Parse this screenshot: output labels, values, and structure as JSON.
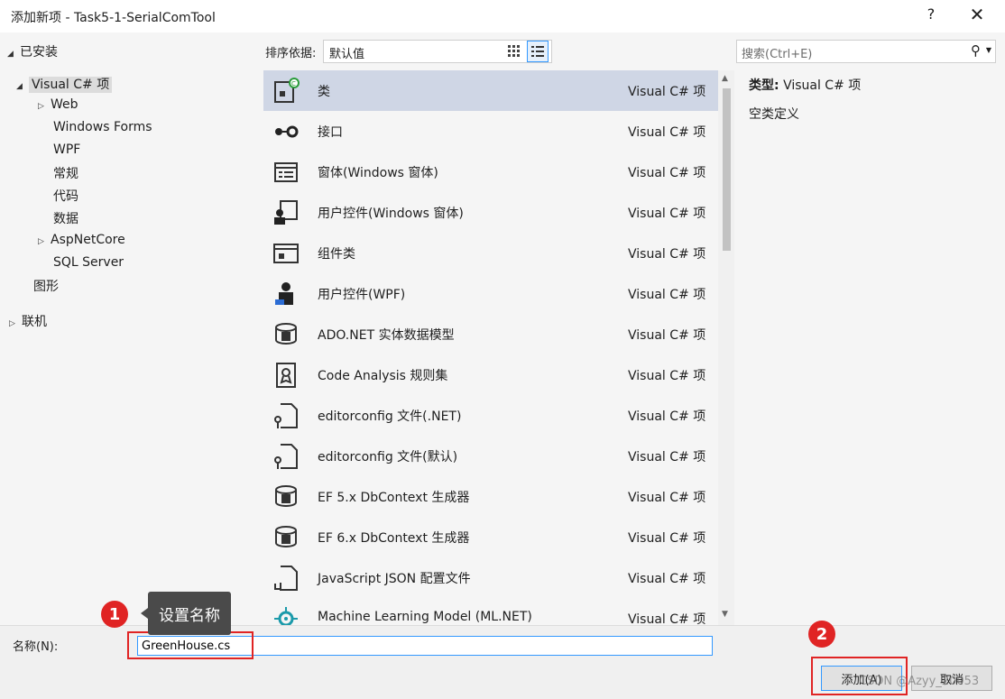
{
  "window": {
    "title": "添加新项 - Task5-1-SerialComTool",
    "help": "?",
    "close": "✕"
  },
  "tree": {
    "installed": "已安装",
    "visual_csharp": "Visual C# 项",
    "web": "Web",
    "windows_forms": "Windows Forms",
    "wpf": "WPF",
    "normal": "常规",
    "code": "代码",
    "data": "数据",
    "aspnetcore": "AspNetCore",
    "sqlserver": "SQL Server",
    "graphics": "图形",
    "online": "联机"
  },
  "sort": {
    "label": "排序依据:",
    "value": "默认值"
  },
  "search": {
    "placeholder": "搜索(Ctrl+E)"
  },
  "items": [
    {
      "name": "类",
      "type": "Visual C# 项",
      "icon": "class-icon"
    },
    {
      "name": "接口",
      "type": "Visual C# 项",
      "icon": "interface-icon"
    },
    {
      "name": "窗体(Windows 窗体)",
      "type": "Visual C# 项",
      "icon": "form-icon"
    },
    {
      "name": "用户控件(Windows 窗体)",
      "type": "Visual C# 项",
      "icon": "usercontrol-icon"
    },
    {
      "name": "组件类",
      "type": "Visual C# 项",
      "icon": "component-icon"
    },
    {
      "name": "用户控件(WPF)",
      "type": "Visual C# 项",
      "icon": "wpf-usercontrol-icon"
    },
    {
      "name": "ADO.NET 实体数据模型",
      "type": "Visual C# 项",
      "icon": "entity-model-icon"
    },
    {
      "name": "Code Analysis 规则集",
      "type": "Visual C# 项",
      "icon": "ruleset-icon"
    },
    {
      "name": "editorconfig 文件(.NET)",
      "type": "Visual C# 项",
      "icon": "editorconfig-icon"
    },
    {
      "name": "editorconfig 文件(默认)",
      "type": "Visual C# 项",
      "icon": "editorconfig-icon"
    },
    {
      "name": "EF 5.x DbContext 生成器",
      "type": "Visual C# 项",
      "icon": "dbcontext-icon"
    },
    {
      "name": "EF 6.x DbContext 生成器",
      "type": "Visual C# 项",
      "icon": "dbcontext-icon"
    },
    {
      "name": "JavaScript JSON 配置文件",
      "type": "Visual C# 项",
      "icon": "json-config-icon"
    },
    {
      "name": "Machine Learning Model (ML.NET)",
      "type": "Visual C# 项",
      "icon": "ml-model-icon"
    }
  ],
  "detail": {
    "type_key": "类型:",
    "type_value": "Visual C# 项",
    "description": "空类定义"
  },
  "name_field": {
    "label": "名称(N):",
    "value": "GreenHouse.cs"
  },
  "buttons": {
    "add": "添加(A)",
    "cancel": "取消"
  },
  "annotations": {
    "badge1": "1",
    "badge2": "2",
    "tooltip": "设置名称",
    "watermark": "CSDN @Azyy_20053"
  },
  "colors": {
    "selection": "#cfd6e5",
    "accent": "#3399ff",
    "annotation_red": "#e02424"
  }
}
